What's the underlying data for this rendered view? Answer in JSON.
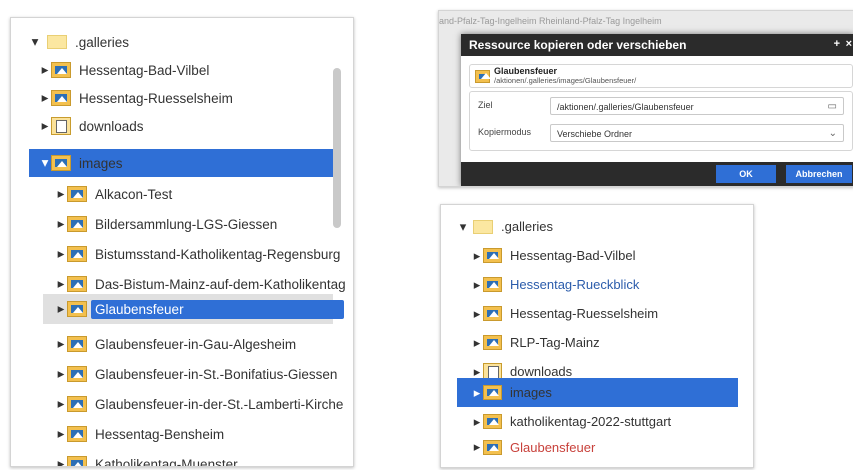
{
  "left_tree": {
    "root_label": ".galleries",
    "items": [
      {
        "label": "Hessentag-Bad-Vilbel",
        "icon": "image-folder-icon"
      },
      {
        "label": "Hessentag-Ruesselsheim",
        "icon": "image-folder-icon"
      },
      {
        "label": "downloads",
        "icon": "document-folder-icon"
      },
      {
        "label": "images",
        "icon": "image-folder-icon",
        "selected": true
      },
      {
        "label": "Alkacon-Test",
        "icon": "image-folder-icon"
      },
      {
        "label": "Bildersammlung-LGS-Giessen",
        "icon": "image-folder-icon"
      },
      {
        "label": "Bistumsstand-Katholikentag-Regensburg",
        "icon": "image-folder-icon"
      },
      {
        "label": "Das-Bistum-Mainz-auf-dem-Katholikentag",
        "icon": "image-folder-icon"
      },
      {
        "label": "Glaubensfeuer",
        "icon": "image-folder-icon",
        "highlighted": true
      },
      {
        "label": "Glaubensfeuer-in-Gau-Algesheim",
        "icon": "image-folder-icon"
      },
      {
        "label": "Glaubensfeuer-in-St.-Bonifatius-Giessen",
        "icon": "image-folder-icon"
      },
      {
        "label": "Glaubensfeuer-in-der-St.-Lamberti-Kirche",
        "icon": "image-folder-icon"
      },
      {
        "label": "Hessentag-Bensheim",
        "icon": "image-folder-icon"
      },
      {
        "label": "Katholikentag-Muenster",
        "icon": "image-folder-icon"
      }
    ]
  },
  "dialog": {
    "background_text": "and-Pfalz-Tag-Ingelheim  Rheinland-Pfalz-Tag Ingelheim",
    "title": "Ressource kopieren oder verschieben",
    "resource_name": "Glaubensfeuer",
    "resource_path": "/aktionen/.galleries/images/Glaubensfeuer/",
    "target_label": "Ziel",
    "target_value": "/aktionen/.galleries/Glaubensfeuer",
    "mode_label": "Kopiermodus",
    "mode_value": "Verschiebe Ordner",
    "ok_label": "OK",
    "cancel_label": "Abbrechen",
    "title_controls": "+ ×"
  },
  "right_tree": {
    "root_label": ".galleries",
    "items": [
      {
        "label": "Hessentag-Bad-Vilbel"
      },
      {
        "label": "Hessentag-Rueckblick"
      },
      {
        "label": "Hessentag-Ruesselsheim"
      },
      {
        "label": "RLP-Tag-Mainz"
      },
      {
        "label": "downloads"
      },
      {
        "label": "images"
      },
      {
        "label": "katholikentag-2022-stuttgart"
      },
      {
        "label": "Glaubensfeuer"
      }
    ]
  },
  "colors": {
    "selection": "#2f6fd6",
    "link_blue": "#2b5cab",
    "moved_red": "#c8413b"
  }
}
